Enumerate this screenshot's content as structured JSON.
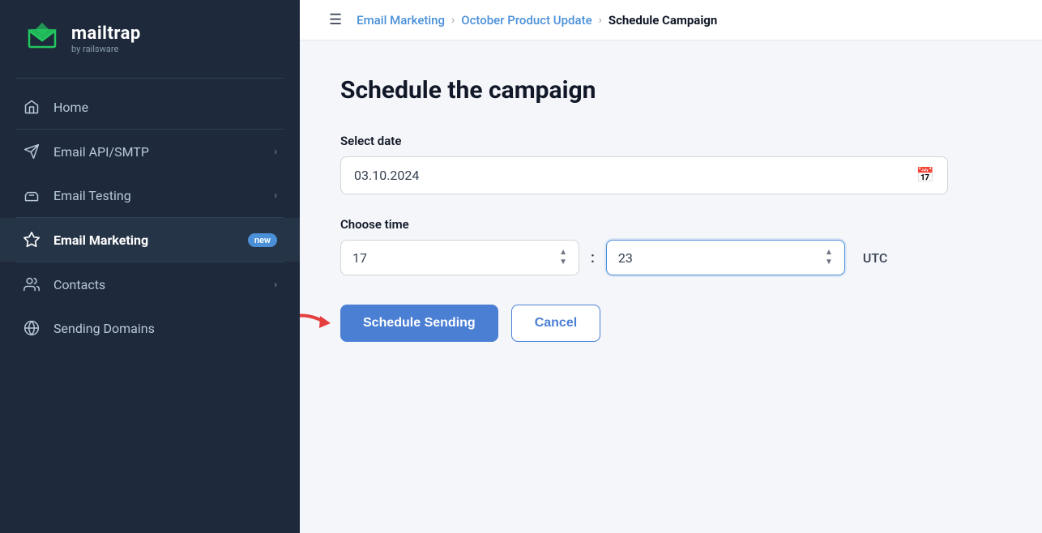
{
  "sidebar": {
    "logo": {
      "name": "mailtrap",
      "sub": "by railsware"
    },
    "nav_items": [
      {
        "id": "home",
        "label": "Home",
        "icon": "home",
        "has_arrow": false,
        "active": false
      },
      {
        "id": "email-api-smtp",
        "label": "Email API/SMTP",
        "icon": "send",
        "has_arrow": true,
        "active": false
      },
      {
        "id": "email-testing",
        "label": "Email Testing",
        "icon": "inbox",
        "has_arrow": true,
        "active": false
      },
      {
        "id": "email-marketing",
        "label": "Email Marketing",
        "icon": "star",
        "has_arrow": false,
        "badge": "new",
        "active": true
      },
      {
        "id": "contacts",
        "label": "Contacts",
        "icon": "users",
        "has_arrow": true,
        "active": false
      },
      {
        "id": "sending-domains",
        "label": "Sending Domains",
        "icon": "globe",
        "has_arrow": false,
        "active": false
      }
    ]
  },
  "topbar": {
    "breadcrumbs": [
      {
        "label": "Email Marketing",
        "link": true
      },
      {
        "label": "October Product Update",
        "link": true
      },
      {
        "label": "Schedule Campaign",
        "link": false
      }
    ]
  },
  "main": {
    "page_title": "Schedule the campaign",
    "date_field": {
      "label": "Select date",
      "value": "03.10.2024"
    },
    "time_field": {
      "label": "Choose time",
      "hour": "17",
      "minute": "23",
      "timezone": "UTC"
    },
    "buttons": {
      "schedule": "Schedule Sending",
      "cancel": "Cancel"
    }
  }
}
